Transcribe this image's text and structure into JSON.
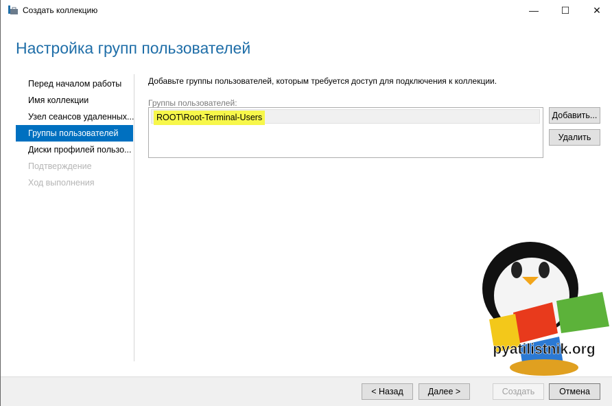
{
  "window": {
    "title": "Создать коллекцию",
    "minimize": "—",
    "maximize": "☐",
    "close": "✕"
  },
  "heading": "Настройка групп пользователей",
  "nav": [
    {
      "label": "Перед началом работы",
      "state": "normal"
    },
    {
      "label": "Имя коллекции",
      "state": "normal"
    },
    {
      "label": "Узел сеансов удаленных...",
      "state": "normal"
    },
    {
      "label": "Группы пользователей",
      "state": "selected"
    },
    {
      "label": "Диски профилей пользо...",
      "state": "normal"
    },
    {
      "label": "Подтверждение",
      "state": "disabled"
    },
    {
      "label": "Ход выполнения",
      "state": "disabled"
    }
  ],
  "content": {
    "description": "Добавьте группы пользователей, которым требуется доступ для подключения к коллекции.",
    "groups_label": "Группы пользователей:",
    "groups": [
      "ROOT\\Root-Terminal-Users"
    ],
    "add_label": "Добавить...",
    "remove_label": "Удалить"
  },
  "footer": {
    "back": "< Назад",
    "next": "Далее >",
    "create": "Создать",
    "cancel": "Отмена"
  },
  "watermark": {
    "text": "pyatilistnik.org"
  },
  "colors": {
    "accent": "#0070c0",
    "heading": "#1f6ea8",
    "highlight": "#f7f74a"
  }
}
